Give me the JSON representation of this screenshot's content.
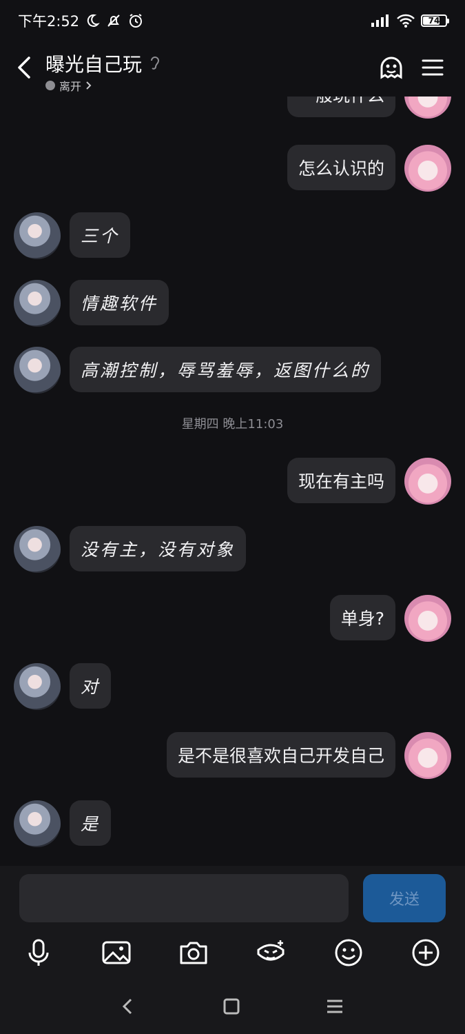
{
  "status": {
    "time": "下午2:52",
    "battery": "74"
  },
  "header": {
    "title": "曝光自己玩",
    "presence": "离开"
  },
  "chat": {
    "partial_top": "一般玩什么",
    "messages": [
      {
        "side": "right",
        "text": "怎么认识的"
      },
      {
        "side": "left",
        "text": "三个"
      },
      {
        "side": "left",
        "text": "情趣软件"
      },
      {
        "side": "left",
        "text": "高潮控制，辱骂羞辱，返图什么的"
      },
      {
        "side": "time",
        "text": "星期四 晚上11:03"
      },
      {
        "side": "right",
        "text": "现在有主吗"
      },
      {
        "side": "left",
        "text": "没有主，没有对象"
      },
      {
        "side": "right",
        "text": "单身?"
      },
      {
        "side": "left",
        "text": "对"
      },
      {
        "side": "right",
        "text": "是不是很喜欢自己开发自己"
      },
      {
        "side": "left",
        "text": "是"
      }
    ]
  },
  "composer": {
    "input_value": "",
    "send_label": "发送"
  },
  "colors": {
    "background": "#111114",
    "bubble": "#2a2a2e",
    "send": "#1c5a98"
  }
}
